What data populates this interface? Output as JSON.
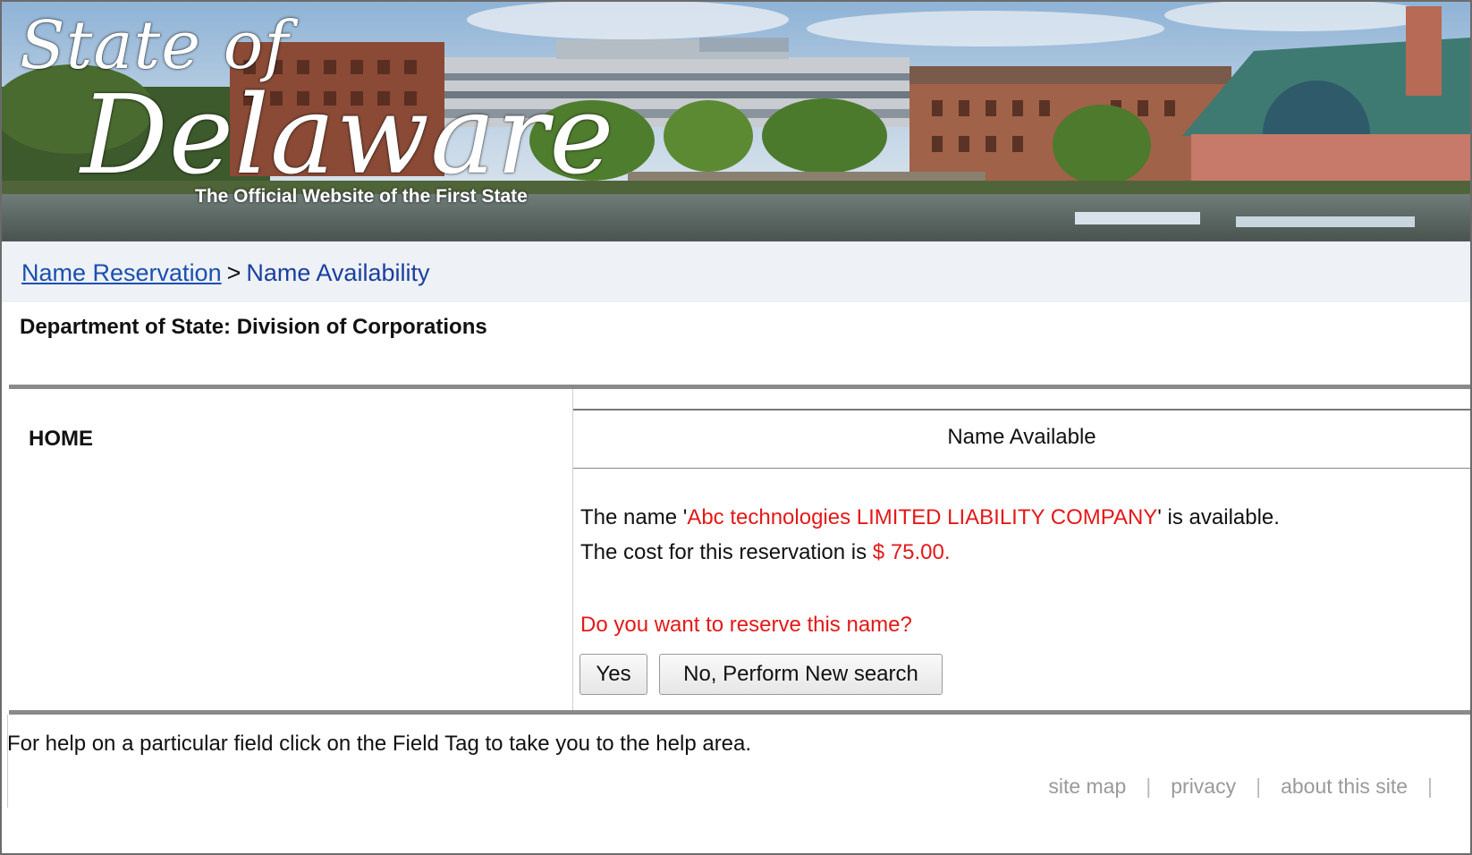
{
  "banner": {
    "title_line1": "State of",
    "title_line2": "Delaware",
    "tagline": "The Official Website of the First State"
  },
  "breadcrumb": {
    "link_label": "Name Reservation",
    "separator": ">",
    "current": "Name Availability"
  },
  "department": "Department of State: Division of Corporations",
  "nav": {
    "home_label": "HOME"
  },
  "result": {
    "header": "Name Available",
    "msg_prefix": "The name '",
    "entity_name": "Abc technologies LIMITED LIABILITY COMPANY",
    "msg_suffix": "' is available.",
    "cost_prefix": "The cost for this reservation is ",
    "cost_value": "$ 75.00.",
    "question": "Do you want to reserve this name?",
    "yes_label": "Yes",
    "no_label": "No, Perform New search"
  },
  "footer": {
    "help_text": "For help on a particular field click on the Field Tag to take you to the help area.",
    "links": [
      "site map",
      "privacy",
      "about this site"
    ]
  },
  "colors": {
    "highlight_red": "#e41818",
    "link_blue": "#1a4fb0",
    "breadcrumb_bg": "#eef1f5"
  }
}
